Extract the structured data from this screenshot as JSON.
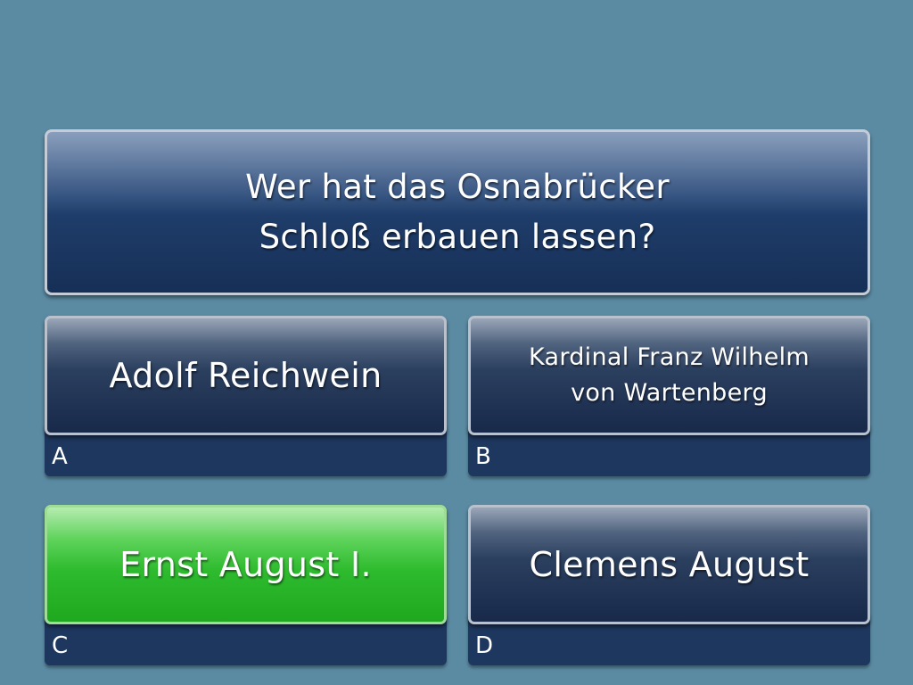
{
  "quiz": {
    "question": "Wer hat das Osnabrücker\nSchloß erbauen lassen?",
    "answers": [
      {
        "letter": "A",
        "text": "Adolf Reichwein",
        "correct": false
      },
      {
        "letter": "B",
        "text": "Kardinal Franz Wilhelm\nvon Wartenberg",
        "correct": false
      },
      {
        "letter": "C",
        "text": "Ernst August I.",
        "correct": true
      },
      {
        "letter": "D",
        "text": "Clemens August",
        "correct": false
      }
    ]
  },
  "colors": {
    "background": "#5b8ba3",
    "correct_answer": "#2ebb2e",
    "answer_panel": "#18294a",
    "letter_strip": "#1e375f"
  }
}
